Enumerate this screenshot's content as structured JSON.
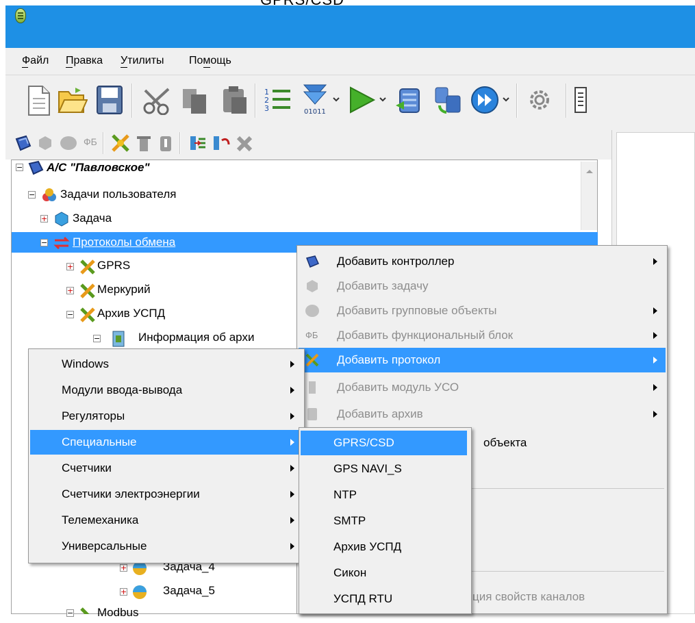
{
  "window": {
    "top_fragment": "GPRS/CSD"
  },
  "menubar": {
    "items": [
      "Файл",
      "Правка",
      "Утилиты",
      "Помощь"
    ]
  },
  "tree": {
    "nodes": [
      {
        "label": "А/С \"Павловское\"",
        "expanded": true,
        "icon": "controller-icon"
      },
      {
        "label": "Задачи пользователя",
        "expanded": true,
        "icon": "tasks-icon"
      },
      {
        "label": "Задача",
        "expanded": false,
        "icon": "task-icon"
      },
      {
        "label": "Протоколы обмена",
        "expanded": true,
        "selected": true,
        "icon": "exchange-icon"
      },
      {
        "label": "GPRS",
        "expanded": false,
        "icon": "protocol-icon"
      },
      {
        "label": "Меркурий",
        "expanded": false,
        "icon": "protocol-icon"
      },
      {
        "label": "Архив УСПД",
        "expanded": true,
        "icon": "protocol-icon"
      },
      {
        "label": "Информация об архи",
        "expanded": true,
        "icon": "archive-info-icon"
      },
      {
        "label": "Задача_4",
        "expanded": false,
        "icon": "task-icon"
      },
      {
        "label": "Задача_5",
        "expanded": false,
        "icon": "task-icon"
      },
      {
        "label": "Modbus",
        "expanded": true,
        "icon": "protocol-icon"
      }
    ]
  },
  "context_menu": {
    "items": [
      {
        "label": "Добавить контроллер",
        "enabled": true,
        "submenu": true,
        "icon": "controller-icon"
      },
      {
        "label": "Добавить задачу",
        "enabled": false,
        "submenu": false,
        "icon": "task-icon"
      },
      {
        "label": "Добавить групповые объекты",
        "enabled": false,
        "submenu": true,
        "icon": "group-icon"
      },
      {
        "label": "Добавить функциональный блок",
        "enabled": false,
        "submenu": true,
        "icon_text": "ФБ"
      },
      {
        "label": "Добавить протокол",
        "enabled": true,
        "submenu": true,
        "highlighted": true,
        "icon": "protocol-icon"
      },
      {
        "label": "Добавить модуль УСО",
        "enabled": false,
        "submenu": true,
        "icon": "module-icon"
      },
      {
        "label": "Добавить архив",
        "enabled": false,
        "submenu": true,
        "icon": "archive-icon"
      },
      {
        "label": "объекта",
        "enabled": true,
        "submenu": false
      },
      {
        "label": "ция свойств каналов",
        "enabled": false,
        "submenu": false
      }
    ]
  },
  "protocol_menu": {
    "items": [
      {
        "label": "Windows",
        "submenu": true
      },
      {
        "label": "Модули ввода-вывода",
        "submenu": true
      },
      {
        "label": "Регуляторы",
        "submenu": true
      },
      {
        "label": "Специальные",
        "submenu": true,
        "highlighted": true
      },
      {
        "label": "Счетчики",
        "submenu": true
      },
      {
        "label": "Счетчики электроэнергии",
        "submenu": true
      },
      {
        "label": "Телемеханика",
        "submenu": true
      },
      {
        "label": "Универсальные",
        "submenu": true
      }
    ]
  },
  "special_menu": {
    "items": [
      {
        "label": "GPRS/CSD",
        "highlighted": true
      },
      {
        "label": "GPS NAVI_S"
      },
      {
        "label": "NTP"
      },
      {
        "label": "SMTP"
      },
      {
        "label": "Архив УСПД"
      },
      {
        "label": "Сикон"
      },
      {
        "label": "УСПД RTU"
      }
    ]
  },
  "colors": {
    "titlebar": "#1e90e5",
    "highlight": "#3399ff",
    "menu_bg": "#f0f0f0"
  }
}
